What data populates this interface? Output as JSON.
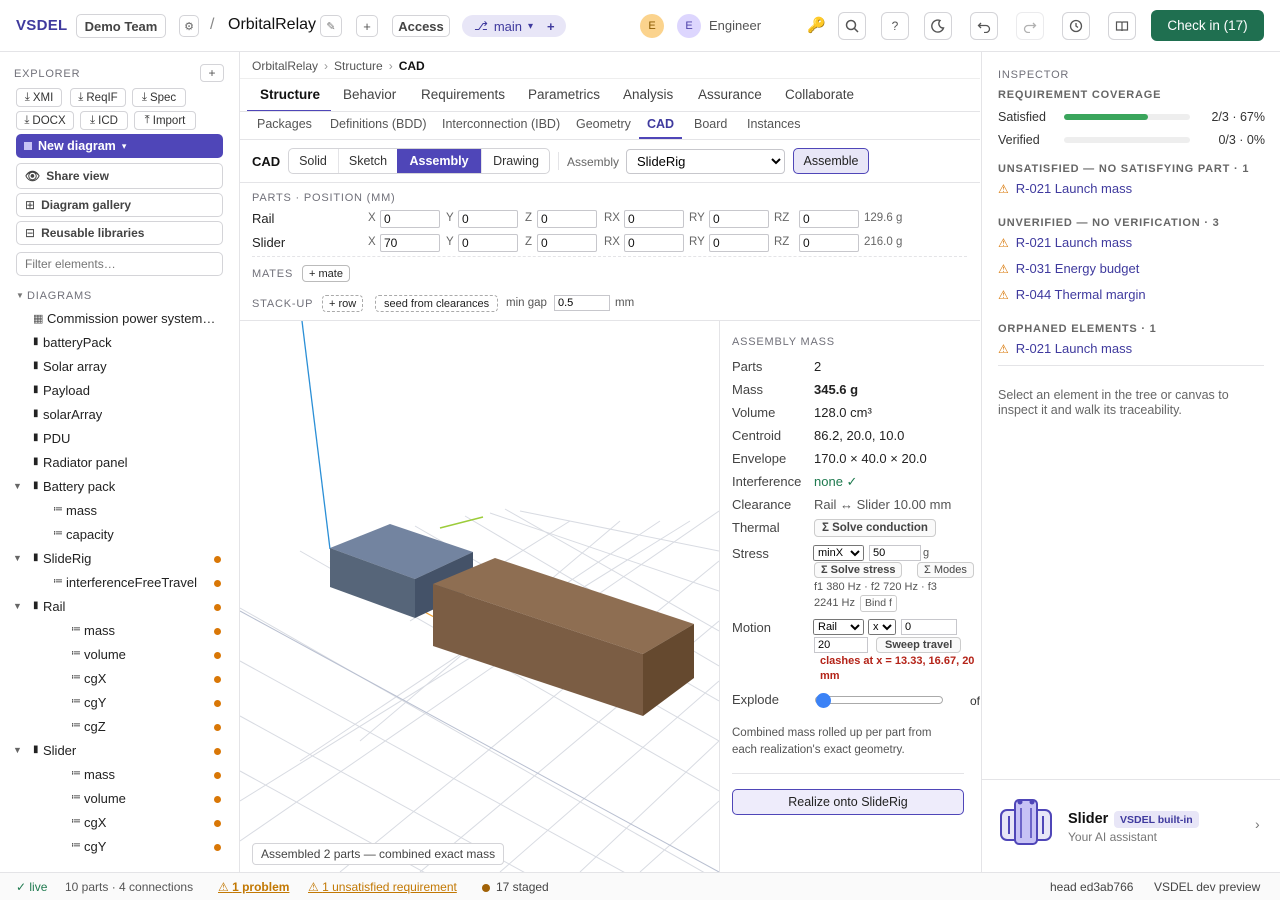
{
  "topbar": {
    "brand": "VSDEL",
    "team": "Demo Team",
    "project": "OrbitalRelay",
    "access": "Access",
    "branch": "main",
    "avatar1": "E",
    "avatar2": "E",
    "role": "Engineer",
    "checkin": "Check in (17)"
  },
  "explorer": {
    "title": "EXPLORER",
    "exports": [
      "XMI",
      "ReqIF",
      "Spec",
      "DOCX",
      "ICD",
      "Import"
    ],
    "new_diagram": "New diagram",
    "share_view": "Share view",
    "gallery": "Diagram gallery",
    "libraries": "Reusable libraries",
    "filter_placeholder": "Filter elements…",
    "diagrams_label": "DIAGRAMS",
    "tree": [
      {
        "label": "Commission power system…",
        "icon": "diagram-icon",
        "indent": 0,
        "dot": false,
        "caret": ""
      },
      {
        "label": "batteryPack",
        "icon": "block-icon",
        "indent": 0,
        "dot": false,
        "caret": ""
      },
      {
        "label": "Solar array",
        "icon": "block-icon",
        "indent": 0,
        "dot": false,
        "caret": ""
      },
      {
        "label": "Payload",
        "icon": "block-icon",
        "indent": 0,
        "dot": false,
        "caret": ""
      },
      {
        "label": "solarArray",
        "icon": "block-icon",
        "indent": 0,
        "dot": false,
        "caret": ""
      },
      {
        "label": "PDU",
        "icon": "block-icon",
        "indent": 0,
        "dot": false,
        "caret": ""
      },
      {
        "label": "Radiator panel",
        "icon": "block-icon",
        "indent": 0,
        "dot": false,
        "caret": ""
      },
      {
        "label": "Battery pack",
        "icon": "block-icon",
        "indent": 0,
        "dot": false,
        "caret": "▼"
      },
      {
        "label": "mass",
        "icon": "value-icon",
        "indent": 2,
        "dot": false,
        "caret": ""
      },
      {
        "label": "capacity",
        "icon": "value-icon",
        "indent": 2,
        "dot": false,
        "caret": ""
      },
      {
        "label": "SlideRig",
        "icon": "block-icon",
        "indent": 0,
        "dot": true,
        "caret": "▼"
      },
      {
        "label": "interferenceFreeTravel",
        "icon": "value-icon",
        "indent": 2,
        "dot": true,
        "caret": ""
      },
      {
        "label": "Rail",
        "icon": "block-icon",
        "indent": 1,
        "dot": true,
        "caret": "▼"
      },
      {
        "label": "mass",
        "icon": "value-icon",
        "indent": 3,
        "dot": true,
        "caret": ""
      },
      {
        "label": "volume",
        "icon": "value-icon",
        "indent": 3,
        "dot": true,
        "caret": ""
      },
      {
        "label": "cgX",
        "icon": "value-icon",
        "indent": 3,
        "dot": true,
        "caret": ""
      },
      {
        "label": "cgY",
        "icon": "value-icon",
        "indent": 3,
        "dot": true,
        "caret": ""
      },
      {
        "label": "cgZ",
        "icon": "value-icon",
        "indent": 3,
        "dot": true,
        "caret": ""
      },
      {
        "label": "Slider",
        "icon": "block-icon",
        "indent": 1,
        "dot": true,
        "caret": "▼"
      },
      {
        "label": "mass",
        "icon": "value-icon",
        "indent": 3,
        "dot": true,
        "caret": ""
      },
      {
        "label": "volume",
        "icon": "value-icon",
        "indent": 3,
        "dot": true,
        "caret": ""
      },
      {
        "label": "cgX",
        "icon": "value-icon",
        "indent": 3,
        "dot": true,
        "caret": ""
      },
      {
        "label": "cgY",
        "icon": "value-icon",
        "indent": 3,
        "dot": true,
        "caret": ""
      }
    ]
  },
  "breadcrumb": [
    "OrbitalRelay",
    "Structure",
    "CAD"
  ],
  "tabs": [
    "Structure",
    "Behavior",
    "Requirements",
    "Parametrics",
    "Analysis",
    "Assurance",
    "Collaborate"
  ],
  "active_tab": "Structure",
  "subtabs": [
    "Packages",
    "Definitions (BDD)",
    "Interconnection (IBD)",
    "Geometry",
    "CAD",
    "Board",
    "Instances"
  ],
  "active_subtab": "CAD",
  "cad": {
    "title": "CAD",
    "modes": [
      "Solid",
      "Sketch",
      "Assembly",
      "Drawing"
    ],
    "active_mode": "Assembly",
    "assembly_label": "Assembly",
    "assembly_selected": "SlideRig",
    "assemble": "Assemble",
    "parts_header": "PARTS · POSITION (MM)",
    "axis_labels": [
      "X",
      "Y",
      "Z",
      "RX",
      "RY",
      "RZ"
    ],
    "parts": [
      {
        "name": "Rail",
        "values": [
          "0",
          "0",
          "0",
          "0",
          "0",
          "0"
        ],
        "mass": "129.6 g"
      },
      {
        "name": "Slider",
        "values": [
          "70",
          "0",
          "0",
          "0",
          "0",
          "0"
        ],
        "mass": "216.0 g"
      }
    ],
    "mates_label": "MATES",
    "mate_btn": "+ mate",
    "stackup_label": "STACK-UP",
    "row_btn": "+ row",
    "seed_btn": "seed from clearances",
    "min_gap_label": "min gap",
    "min_gap": "0.5",
    "min_gap_unit": "mm",
    "viewport_caption": "Assembled 2 parts — combined exact mass"
  },
  "assembly_mass": {
    "title": "ASSEMBLY MASS",
    "parts_label": "Parts",
    "parts": "2",
    "mass_label": "Mass",
    "mass": "345.6 g",
    "volume_label": "Volume",
    "volume": "128.0 cm³",
    "centroid_label": "Centroid",
    "centroid": "86.2, 20.0, 10.0",
    "envelope_label": "Envelope",
    "envelope": "170.0 × 40.0 × 20.0",
    "interference_label": "Interference",
    "interference": "none ✓",
    "clearance_label": "Clearance",
    "clearance": "Rail ↔ Slider 10.00 mm",
    "thermal_label": "Thermal",
    "thermal_btn": "Σ Solve conduction",
    "stress_label": "Stress",
    "stress_select": "minX",
    "stress_value": "50",
    "stress_unit": "g",
    "solve_stress": "Σ Solve stress",
    "modes_btn": "Σ Modes",
    "modes_text": "f1 380 Hz · f2 720 Hz · f3 2241 Hz",
    "bind_btn": "Bind f",
    "motion_label": "Motion",
    "motion_part": "Rail",
    "motion_axis": "x",
    "motion_from": "0",
    "motion_to": "20",
    "sweep_btn": "Sweep travel",
    "clash_text": "clashes at x = 13.33, 16.67, 20 mm",
    "explode_label": "Explode",
    "explode_value": 0,
    "explode_state": "of",
    "note": "Combined mass rolled up per part from each realization's exact geometry.",
    "realize_btn": "Realize onto SlideRig"
  },
  "inspector": {
    "title": "INSPECTOR",
    "coverage_title": "REQUIREMENT COVERAGE",
    "satisfied_label": "Satisfied",
    "satisfied_value": "2/3 · 67%",
    "satisfied_fraction": 0.67,
    "verified_label": "Verified",
    "verified_value": "0/3 · 0%",
    "verified_fraction": 0,
    "unsatisfied_title": "UNSATISFIED — NO SATISFYING PART · 1",
    "unsatisfied": [
      "R-021 Launch mass"
    ],
    "unverified_title": "UNVERIFIED — NO VERIFICATION · 3",
    "unverified": [
      "R-021 Launch mass",
      "R-031 Energy budget",
      "R-044 Thermal margin"
    ],
    "orphaned_title": "ORPHANED ELEMENTS · 1",
    "orphaned": [
      "R-021 Launch mass"
    ],
    "hint": "Select an element in the tree or canvas to inspect it and walk its traceability.",
    "assistant_name": "Slider",
    "assistant_badge": "VSDEL built-in",
    "assistant_sub": "Your AI assistant"
  },
  "status": {
    "live": "live",
    "counts": "10 parts · 4 connections",
    "problem": "1 problem",
    "unsatisfied": "1 unsatisfied requirement",
    "staged": "17 staged",
    "head": "head ed3ab766",
    "env": "VSDEL dev preview"
  },
  "colors": {
    "accent": "#3f3a9e",
    "primary": "#1f6f50",
    "warn": "#d97706",
    "rail": "#566579",
    "slider": "#7b5d44"
  }
}
